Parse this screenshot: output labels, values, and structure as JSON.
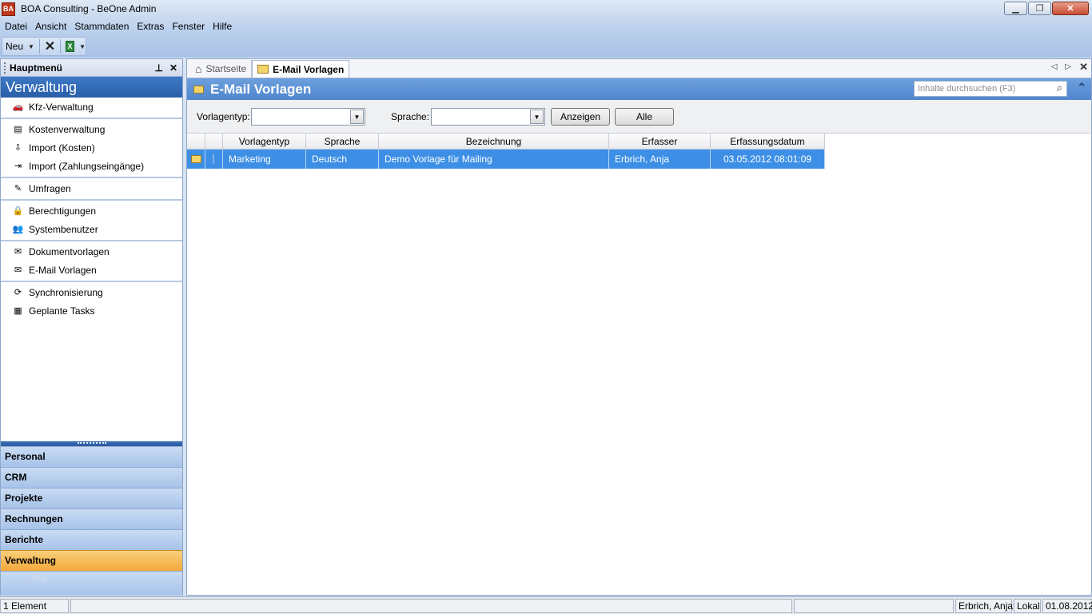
{
  "window": {
    "app_icon_text": "BA",
    "title": "BOA Consulting - BeOne Admin",
    "min_label": "▁",
    "restore_label": "❐",
    "close_label": "✕"
  },
  "menu": [
    "Datei",
    "Ansicht",
    "Stammdaten",
    "Extras",
    "Fenster",
    "Hilfe"
  ],
  "toolbar": {
    "new_label": "Neu",
    "delete_icon": "✕",
    "excel_icon": "X"
  },
  "left_panel": {
    "title": "Hauptmenü",
    "pin_icon": "⊥",
    "close_icon": "✕",
    "section_title": "Verwaltung",
    "groups": [
      [
        {
          "label": "Kfz-Verwaltung",
          "icon": "🚗"
        }
      ],
      [
        {
          "label": "Kostenverwaltung",
          "icon": "▤"
        },
        {
          "label": "Import (Kosten)",
          "icon": "⇩"
        },
        {
          "label": "Import (Zahlungseingänge)",
          "icon": "⇥"
        }
      ],
      [
        {
          "label": "Umfragen",
          "icon": "✎"
        }
      ],
      [
        {
          "label": "Berechtigungen",
          "icon": "🔒"
        },
        {
          "label": "Systembenutzer",
          "icon": "👥"
        }
      ],
      [
        {
          "label": "Dokumentvorlagen",
          "icon": "✉"
        },
        {
          "label": "E-Mail Vorlagen",
          "icon": "✉"
        }
      ],
      [
        {
          "label": "Synchronisierung",
          "icon": "⟳"
        },
        {
          "label": "Geplante Tasks",
          "icon": "▦"
        }
      ]
    ],
    "nav": [
      "Personal",
      "CRM",
      "Projekte",
      "Rechnungen",
      "Berichte",
      "Verwaltung"
    ],
    "nav_active": "Verwaltung",
    "bottom_text": "Blog"
  },
  "tabs": [
    {
      "label": "Startseite",
      "active": false
    },
    {
      "label": "E-Mail Vorlagen",
      "active": true
    }
  ],
  "page": {
    "title": "E-Mail Vorlagen",
    "search_placeholder": "Inhalte durchsuchen (F3)"
  },
  "filters": {
    "type_label": "Vorlagentyp:",
    "type_value": "",
    "lang_label": "Sprache:",
    "lang_value": "",
    "show_button": "Anzeigen",
    "all_button": "Alle"
  },
  "grid": {
    "columns": [
      "Vorlagentyp",
      "Sprache",
      "Bezeichnung",
      "Erfasser",
      "Erfassungsdatum"
    ],
    "rows": [
      {
        "Vorlagentyp": "Marketing",
        "Sprache": "Deutsch",
        "Bezeichnung": "Demo Vorlage für Mailing",
        "Erfasser": "Erbrich, Anja",
        "Erfassungsdatum": "03.05.2012 08:01:09"
      }
    ]
  },
  "status": {
    "count": "1 Element",
    "user": "Erbrich, Anja",
    "location": "Lokal",
    "date": "01.08.2012"
  },
  "colors": {
    "section_blue": "#2a5fa8",
    "selection_blue": "#3d8fe6",
    "active_nav_orange": "#f2a93a"
  }
}
